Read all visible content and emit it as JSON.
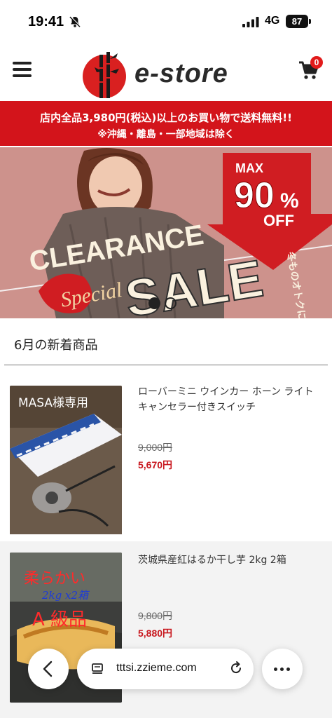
{
  "status": {
    "time": "19:41",
    "network": "4G",
    "battery": "87"
  },
  "header": {
    "brand": "e-store",
    "cart_count": "0"
  },
  "notice": {
    "line1": "店内全品3,980円(税込)以上のお買い物で送料無料!!",
    "line2": "※沖縄・離島・一部地域は除く"
  },
  "hero": {
    "max": "MAX",
    "percent": "90",
    "percent_sign": "%",
    "off": "OFF",
    "clearance": "CLEARANCE",
    "special": "Special",
    "sale": "SALE",
    "side_text": "冬ものオトクにGET!"
  },
  "section": {
    "title": "6月の新着商品"
  },
  "products": [
    {
      "name": "ローバーミニ ウインカー ホーン ライト キャンセラー付きスイッチ",
      "old_price": "9,000円",
      "price": "5,670円",
      "thumb_label": "MASA様専用"
    },
    {
      "name": "茨城県産紅はるか干し芋 2kg 2箱",
      "old_price": "9,800円",
      "price": "5,880円",
      "thumb_label1": "柔らかい",
      "thumb_label2": "2kg x2箱",
      "thumb_label3": "A 級品"
    }
  ],
  "browser": {
    "url": "tttsi.zzieme.com"
  },
  "colors": {
    "accent_red": "#d3141b",
    "price_red": "#c8161d"
  }
}
